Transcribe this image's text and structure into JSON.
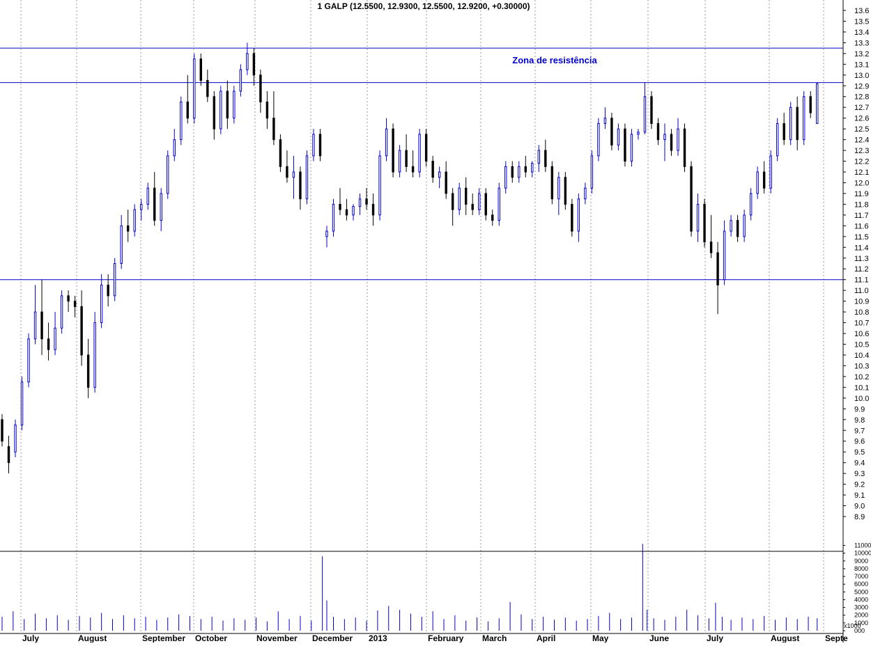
{
  "chart_data": {
    "type": "candlestick",
    "title": "1 GALP (12.5500, 12.9300, 12.5500, 12.9200, +0.30000)",
    "annotation": "Zona de resistência",
    "colors": {
      "up": "#0000cc",
      "down": "#000000",
      "line": "#0000cc",
      "grid": "#999999",
      "volume": "#0000cc"
    },
    "grid": true,
    "price_axis": {
      "min": 8.9,
      "max": 13.6,
      "step": 0.1,
      "labels": [
        "13.6",
        "13.5",
        "13.4",
        "13.3",
        "13.2",
        "13.1",
        "13.0",
        "12.9",
        "12.8",
        "12.7",
        "12.6",
        "12.5",
        "12.4",
        "12.3",
        "12.2",
        "12.1",
        "12.0",
        "11.9",
        "11.8",
        "11.7",
        "11.6",
        "11.5",
        "11.4",
        "11.3",
        "11.2",
        "11.1",
        "11.0",
        "10.9",
        "10.8",
        "10.7",
        "10.6",
        "10.5",
        "10.4",
        "10.3",
        "10.2",
        "10.1",
        "10.0",
        "9.9",
        "9.8",
        "9.7",
        "9.6",
        "9.5",
        "9.4",
        "9.3",
        "9.2",
        "9.1",
        "9.0",
        "8.9"
      ]
    },
    "volume_axis": {
      "min": 0,
      "max": 11500,
      "labels": [
        "11000",
        "10000",
        "9000",
        "8000",
        "7000",
        "6000",
        "5000",
        "4000",
        "3000",
        "2000",
        "1000",
        "000"
      ],
      "unit_label": "x1000"
    },
    "months": [
      "July",
      "August",
      "September",
      "October",
      "November",
      "December",
      "2013",
      "February",
      "March",
      "April",
      "May",
      "June",
      "July",
      "August",
      "Septe"
    ],
    "horizontal_lines": [
      13.25,
      12.93,
      11.1
    ],
    "series": [
      {
        "t": 0,
        "o": 9.8,
        "h": 9.85,
        "l": 9.55,
        "c": 9.6
      },
      {
        "t": 3,
        "o": 9.55,
        "h": 9.65,
        "l": 9.3,
        "c": 9.4
      },
      {
        "t": 6,
        "o": 9.5,
        "h": 9.8,
        "l": 9.45,
        "c": 9.75
      },
      {
        "t": 9,
        "o": 9.75,
        "h": 10.2,
        "l": 9.7,
        "c": 10.15
      },
      {
        "t": 12,
        "o": 10.15,
        "h": 10.6,
        "l": 10.1,
        "c": 10.55
      },
      {
        "t": 15,
        "o": 10.55,
        "h": 11.05,
        "l": 10.5,
        "c": 10.8
      },
      {
        "t": 18,
        "o": 10.8,
        "h": 11.1,
        "l": 10.4,
        "c": 10.55
      },
      {
        "t": 21,
        "o": 10.55,
        "h": 10.7,
        "l": 10.35,
        "c": 10.45
      },
      {
        "t": 24,
        "o": 10.45,
        "h": 10.8,
        "l": 10.4,
        "c": 10.65
      },
      {
        "t": 27,
        "o": 10.65,
        "h": 11.0,
        "l": 10.6,
        "c": 10.95
      },
      {
        "t": 30,
        "o": 10.95,
        "h": 11.0,
        "l": 10.8,
        "c": 10.9
      },
      {
        "t": 33,
        "o": 10.9,
        "h": 10.95,
        "l": 10.75,
        "c": 10.85
      },
      {
        "t": 36,
        "o": 10.85,
        "h": 11.0,
        "l": 10.3,
        "c": 10.4
      },
      {
        "t": 39,
        "o": 10.4,
        "h": 10.55,
        "l": 10.0,
        "c": 10.1
      },
      {
        "t": 42,
        "o": 10.1,
        "h": 10.8,
        "l": 10.05,
        "c": 10.7
      },
      {
        "t": 45,
        "o": 10.7,
        "h": 11.15,
        "l": 10.65,
        "c": 11.05
      },
      {
        "t": 48,
        "o": 11.05,
        "h": 11.15,
        "l": 10.85,
        "c": 10.95
      },
      {
        "t": 51,
        "o": 10.95,
        "h": 11.3,
        "l": 10.9,
        "c": 11.25
      },
      {
        "t": 54,
        "o": 11.25,
        "h": 11.7,
        "l": 11.2,
        "c": 11.6
      },
      {
        "t": 57,
        "o": 11.6,
        "h": 11.75,
        "l": 11.45,
        "c": 11.55
      },
      {
        "t": 60,
        "o": 11.55,
        "h": 11.8,
        "l": 11.5,
        "c": 11.75
      },
      {
        "t": 63,
        "o": 11.75,
        "h": 11.85,
        "l": 11.65,
        "c": 11.8
      },
      {
        "t": 66,
        "o": 11.8,
        "h": 12.0,
        "l": 11.75,
        "c": 11.95
      },
      {
        "t": 69,
        "o": 11.95,
        "h": 12.1,
        "l": 11.6,
        "c": 11.65
      },
      {
        "t": 72,
        "o": 11.65,
        "h": 11.95,
        "l": 11.55,
        "c": 11.9
      },
      {
        "t": 75,
        "o": 11.9,
        "h": 12.3,
        "l": 11.85,
        "c": 12.25
      },
      {
        "t": 78,
        "o": 12.25,
        "h": 12.5,
        "l": 12.2,
        "c": 12.4
      },
      {
        "t": 81,
        "o": 12.4,
        "h": 12.8,
        "l": 12.35,
        "c": 12.75
      },
      {
        "t": 84,
        "o": 12.75,
        "h": 13.0,
        "l": 12.55,
        "c": 12.6
      },
      {
        "t": 87,
        "o": 12.6,
        "h": 13.2,
        "l": 12.55,
        "c": 13.15
      },
      {
        "t": 90,
        "o": 13.15,
        "h": 13.2,
        "l": 12.9,
        "c": 12.95
      },
      {
        "t": 93,
        "o": 12.95,
        "h": 13.05,
        "l": 12.75,
        "c": 12.8
      },
      {
        "t": 96,
        "o": 12.8,
        "h": 12.85,
        "l": 12.4,
        "c": 12.5
      },
      {
        "t": 99,
        "o": 12.5,
        "h": 12.9,
        "l": 12.45,
        "c": 12.85
      },
      {
        "t": 102,
        "o": 12.85,
        "h": 12.95,
        "l": 12.5,
        "c": 12.6
      },
      {
        "t": 105,
        "o": 12.6,
        "h": 12.9,
        "l": 12.55,
        "c": 12.85
      },
      {
        "t": 108,
        "o": 12.85,
        "h": 13.1,
        "l": 12.8,
        "c": 13.05
      },
      {
        "t": 111,
        "o": 13.05,
        "h": 13.3,
        "l": 13.0,
        "c": 13.2
      },
      {
        "t": 114,
        "o": 13.2,
        "h": 13.25,
        "l": 12.9,
        "c": 13.0
      },
      {
        "t": 117,
        "o": 13.0,
        "h": 13.05,
        "l": 12.65,
        "c": 12.75
      },
      {
        "t": 120,
        "o": 12.75,
        "h": 12.85,
        "l": 12.5,
        "c": 12.6
      },
      {
        "t": 123,
        "o": 12.6,
        "h": 12.85,
        "l": 12.35,
        "c": 12.4
      },
      {
        "t": 126,
        "o": 12.4,
        "h": 12.45,
        "l": 12.1,
        "c": 12.15
      },
      {
        "t": 129,
        "o": 12.15,
        "h": 12.3,
        "l": 12.0,
        "c": 12.05
      },
      {
        "t": 132,
        "o": 12.05,
        "h": 12.25,
        "l": 11.85,
        "c": 12.1
      },
      {
        "t": 135,
        "o": 12.1,
        "h": 12.15,
        "l": 11.75,
        "c": 11.85
      },
      {
        "t": 138,
        "o": 11.85,
        "h": 12.3,
        "l": 11.8,
        "c": 12.25
      },
      {
        "t": 141,
        "o": 12.25,
        "h": 12.5,
        "l": 12.2,
        "c": 12.45
      },
      {
        "t": 144,
        "o": 12.45,
        "h": 12.5,
        "l": 12.2,
        "c": 12.25
      },
      {
        "t": 147,
        "o": 11.5,
        "h": 11.6,
        "l": 11.4,
        "c": 11.55
      },
      {
        "t": 150,
        "o": 11.55,
        "h": 11.85,
        "l": 11.5,
        "c": 11.8
      },
      {
        "t": 153,
        "o": 11.8,
        "h": 11.95,
        "l": 11.7,
        "c": 11.75
      },
      {
        "t": 156,
        "o": 11.75,
        "h": 11.85,
        "l": 11.65,
        "c": 11.7
      },
      {
        "t": 159,
        "o": 11.7,
        "h": 11.8,
        "l": 11.65,
        "c": 11.78
      },
      {
        "t": 162,
        "o": 11.78,
        "h": 11.9,
        "l": 11.7,
        "c": 11.85
      },
      {
        "t": 165,
        "o": 11.85,
        "h": 11.95,
        "l": 11.75,
        "c": 11.8
      },
      {
        "t": 168,
        "o": 11.8,
        "h": 11.9,
        "l": 11.6,
        "c": 11.7
      },
      {
        "t": 171,
        "o": 11.7,
        "h": 12.3,
        "l": 11.65,
        "c": 12.25
      },
      {
        "t": 174,
        "o": 12.25,
        "h": 12.6,
        "l": 12.2,
        "c": 12.5
      },
      {
        "t": 177,
        "o": 12.5,
        "h": 12.55,
        "l": 12.05,
        "c": 12.1
      },
      {
        "t": 180,
        "o": 12.1,
        "h": 12.35,
        "l": 12.05,
        "c": 12.3
      },
      {
        "t": 183,
        "o": 12.3,
        "h": 12.45,
        "l": 12.1,
        "c": 12.15
      },
      {
        "t": 186,
        "o": 12.15,
        "h": 12.3,
        "l": 12.05,
        "c": 12.1
      },
      {
        "t": 189,
        "o": 12.1,
        "h": 12.5,
        "l": 12.05,
        "c": 12.45
      },
      {
        "t": 192,
        "o": 12.45,
        "h": 12.5,
        "l": 12.15,
        "c": 12.2
      },
      {
        "t": 195,
        "o": 12.2,
        "h": 12.25,
        "l": 12.0,
        "c": 12.05
      },
      {
        "t": 198,
        "o": 12.05,
        "h": 12.15,
        "l": 11.95,
        "c": 12.1
      },
      {
        "t": 201,
        "o": 12.1,
        "h": 12.2,
        "l": 11.85,
        "c": 11.9
      },
      {
        "t": 204,
        "o": 11.9,
        "h": 11.95,
        "l": 11.6,
        "c": 11.75
      },
      {
        "t": 207,
        "o": 11.75,
        "h": 12.0,
        "l": 11.7,
        "c": 11.95
      },
      {
        "t": 210,
        "o": 11.95,
        "h": 12.05,
        "l": 11.7,
        "c": 11.8
      },
      {
        "t": 213,
        "o": 11.8,
        "h": 11.9,
        "l": 11.7,
        "c": 11.75
      },
      {
        "t": 216,
        "o": 11.75,
        "h": 11.95,
        "l": 11.7,
        "c": 11.9
      },
      {
        "t": 219,
        "o": 11.9,
        "h": 11.95,
        "l": 11.65,
        "c": 11.7
      },
      {
        "t": 222,
        "o": 11.7,
        "h": 11.75,
        "l": 11.6,
        "c": 11.65
      },
      {
        "t": 225,
        "o": 11.65,
        "h": 12.0,
        "l": 11.6,
        "c": 11.95
      },
      {
        "t": 228,
        "o": 11.95,
        "h": 12.2,
        "l": 11.9,
        "c": 12.15
      },
      {
        "t": 231,
        "o": 12.15,
        "h": 12.2,
        "l": 12.0,
        "c": 12.05
      },
      {
        "t": 234,
        "o": 12.05,
        "h": 12.2,
        "l": 12.0,
        "c": 12.15
      },
      {
        "t": 237,
        "o": 12.15,
        "h": 12.25,
        "l": 12.05,
        "c": 12.1
      },
      {
        "t": 240,
        "o": 12.1,
        "h": 12.2,
        "l": 12.05,
        "c": 12.18
      },
      {
        "t": 243,
        "o": 12.18,
        "h": 12.35,
        "l": 12.1,
        "c": 12.3
      },
      {
        "t": 246,
        "o": 12.3,
        "h": 12.4,
        "l": 12.1,
        "c": 12.15
      },
      {
        "t": 249,
        "o": 12.15,
        "h": 12.2,
        "l": 11.8,
        "c": 11.85
      },
      {
        "t": 252,
        "o": 11.85,
        "h": 12.1,
        "l": 11.7,
        "c": 12.05
      },
      {
        "t": 255,
        "o": 12.05,
        "h": 12.1,
        "l": 11.75,
        "c": 11.8
      },
      {
        "t": 258,
        "o": 11.8,
        "h": 11.85,
        "l": 11.5,
        "c": 11.55
      },
      {
        "t": 261,
        "o": 11.55,
        "h": 11.9,
        "l": 11.45,
        "c": 11.85
      },
      {
        "t": 264,
        "o": 11.85,
        "h": 12.0,
        "l": 11.8,
        "c": 11.95
      },
      {
        "t": 267,
        "o": 11.95,
        "h": 12.3,
        "l": 11.9,
        "c": 12.25
      },
      {
        "t": 270,
        "o": 12.25,
        "h": 12.6,
        "l": 12.2,
        "c": 12.55
      },
      {
        "t": 273,
        "o": 12.55,
        "h": 12.7,
        "l": 12.5,
        "c": 12.6
      },
      {
        "t": 276,
        "o": 12.6,
        "h": 12.65,
        "l": 12.3,
        "c": 12.35
      },
      {
        "t": 279,
        "o": 12.35,
        "h": 12.55,
        "l": 12.3,
        "c": 12.5
      },
      {
        "t": 282,
        "o": 12.5,
        "h": 12.55,
        "l": 12.15,
        "c": 12.2
      },
      {
        "t": 285,
        "o": 12.2,
        "h": 12.5,
        "l": 12.15,
        "c": 12.45
      },
      {
        "t": 288,
        "o": 12.45,
        "h": 12.5,
        "l": 12.4,
        "c": 12.47
      },
      {
        "t": 291,
        "o": 12.47,
        "h": 12.93,
        "l": 12.45,
        "c": 12.8
      },
      {
        "t": 294,
        "o": 12.8,
        "h": 12.85,
        "l": 12.5,
        "c": 12.55
      },
      {
        "t": 297,
        "o": 12.55,
        "h": 12.6,
        "l": 12.35,
        "c": 12.4
      },
      {
        "t": 300,
        "o": 12.4,
        "h": 12.55,
        "l": 12.2,
        "c": 12.45
      },
      {
        "t": 303,
        "o": 12.45,
        "h": 12.5,
        "l": 12.25,
        "c": 12.3
      },
      {
        "t": 306,
        "o": 12.3,
        "h": 12.6,
        "l": 12.25,
        "c": 12.5
      },
      {
        "t": 309,
        "o": 12.5,
        "h": 12.55,
        "l": 12.1,
        "c": 12.15
      },
      {
        "t": 312,
        "o": 12.15,
        "h": 12.2,
        "l": 11.5,
        "c": 11.55
      },
      {
        "t": 315,
        "o": 11.55,
        "h": 11.9,
        "l": 11.45,
        "c": 11.8
      },
      {
        "t": 318,
        "o": 11.8,
        "h": 11.85,
        "l": 11.4,
        "c": 11.45
      },
      {
        "t": 321,
        "o": 11.45,
        "h": 11.7,
        "l": 11.3,
        "c": 11.35
      },
      {
        "t": 324,
        "o": 11.35,
        "h": 11.45,
        "l": 10.78,
        "c": 11.05
      },
      {
        "t": 327,
        "o": 11.1,
        "h": 11.65,
        "l": 11.05,
        "c": 11.55
      },
      {
        "t": 330,
        "o": 11.55,
        "h": 11.7,
        "l": 11.5,
        "c": 11.65
      },
      {
        "t": 333,
        "o": 11.65,
        "h": 11.7,
        "l": 11.45,
        "c": 11.5
      },
      {
        "t": 336,
        "o": 11.5,
        "h": 11.75,
        "l": 11.45,
        "c": 11.7
      },
      {
        "t": 339,
        "o": 11.7,
        "h": 11.95,
        "l": 11.65,
        "c": 11.9
      },
      {
        "t": 342,
        "o": 11.9,
        "h": 12.15,
        "l": 11.85,
        "c": 12.1
      },
      {
        "t": 345,
        "o": 12.1,
        "h": 12.2,
        "l": 11.9,
        "c": 11.95
      },
      {
        "t": 348,
        "o": 11.95,
        "h": 12.3,
        "l": 11.9,
        "c": 12.25
      },
      {
        "t": 351,
        "o": 12.25,
        "h": 12.6,
        "l": 12.2,
        "c": 12.55
      },
      {
        "t": 354,
        "o": 12.55,
        "h": 12.65,
        "l": 12.35,
        "c": 12.4
      },
      {
        "t": 357,
        "o": 12.4,
        "h": 12.75,
        "l": 12.35,
        "c": 12.7
      },
      {
        "t": 360,
        "o": 12.7,
        "h": 12.8,
        "l": 12.3,
        "c": 12.4
      },
      {
        "t": 363,
        "o": 12.4,
        "h": 12.85,
        "l": 12.35,
        "c": 12.8
      },
      {
        "t": 366,
        "o": 12.8,
        "h": 12.85,
        "l": 12.6,
        "c": 12.65
      },
      {
        "t": 369,
        "o": 12.55,
        "h": 12.93,
        "l": 12.55,
        "c": 12.92
      }
    ],
    "volume": [
      {
        "t": 0,
        "v": 1800
      },
      {
        "t": 5,
        "v": 2500
      },
      {
        "t": 10,
        "v": 1500
      },
      {
        "t": 15,
        "v": 2200
      },
      {
        "t": 20,
        "v": 1600
      },
      {
        "t": 25,
        "v": 2000
      },
      {
        "t": 30,
        "v": 1400
      },
      {
        "t": 35,
        "v": 1900
      },
      {
        "t": 40,
        "v": 1700
      },
      {
        "t": 45,
        "v": 2300
      },
      {
        "t": 50,
        "v": 1500
      },
      {
        "t": 55,
        "v": 2000
      },
      {
        "t": 60,
        "v": 1600
      },
      {
        "t": 65,
        "v": 1800
      },
      {
        "t": 70,
        "v": 1400
      },
      {
        "t": 75,
        "v": 1700
      },
      {
        "t": 80,
        "v": 2100
      },
      {
        "t": 85,
        "v": 1900
      },
      {
        "t": 90,
        "v": 1500
      },
      {
        "t": 95,
        "v": 1800
      },
      {
        "t": 100,
        "v": 1300
      },
      {
        "t": 105,
        "v": 1600
      },
      {
        "t": 110,
        "v": 1400
      },
      {
        "t": 115,
        "v": 1700
      },
      {
        "t": 120,
        "v": 1200
      },
      {
        "t": 125,
        "v": 2500
      },
      {
        "t": 130,
        "v": 1500
      },
      {
        "t": 135,
        "v": 1900
      },
      {
        "t": 140,
        "v": 1300
      },
      {
        "t": 145,
        "v": 9600
      },
      {
        "t": 147,
        "v": 3900
      },
      {
        "t": 150,
        "v": 1800
      },
      {
        "t": 155,
        "v": 1500
      },
      {
        "t": 160,
        "v": 1700
      },
      {
        "t": 165,
        "v": 1300
      },
      {
        "t": 170,
        "v": 2600
      },
      {
        "t": 175,
        "v": 3200
      },
      {
        "t": 180,
        "v": 2700
      },
      {
        "t": 185,
        "v": 2200
      },
      {
        "t": 190,
        "v": 1800
      },
      {
        "t": 195,
        "v": 2500
      },
      {
        "t": 200,
        "v": 1500
      },
      {
        "t": 205,
        "v": 2000
      },
      {
        "t": 210,
        "v": 1300
      },
      {
        "t": 215,
        "v": 1700
      },
      {
        "t": 220,
        "v": 1200
      },
      {
        "t": 225,
        "v": 1600
      },
      {
        "t": 230,
        "v": 3700
      },
      {
        "t": 235,
        "v": 2100
      },
      {
        "t": 240,
        "v": 1500
      },
      {
        "t": 245,
        "v": 1800
      },
      {
        "t": 250,
        "v": 1400
      },
      {
        "t": 255,
        "v": 1700
      },
      {
        "t": 260,
        "v": 1300
      },
      {
        "t": 265,
        "v": 1500
      },
      {
        "t": 270,
        "v": 1900
      },
      {
        "t": 275,
        "v": 2300
      },
      {
        "t": 280,
        "v": 1500
      },
      {
        "t": 285,
        "v": 1700
      },
      {
        "t": 290,
        "v": 11200
      },
      {
        "t": 292,
        "v": 2700
      },
      {
        "t": 295,
        "v": 1600
      },
      {
        "t": 300,
        "v": 1400
      },
      {
        "t": 305,
        "v": 1800
      },
      {
        "t": 310,
        "v": 2700
      },
      {
        "t": 315,
        "v": 2000
      },
      {
        "t": 320,
        "v": 1600
      },
      {
        "t": 323,
        "v": 3600
      },
      {
        "t": 326,
        "v": 1800
      },
      {
        "t": 330,
        "v": 1400
      },
      {
        "t": 335,
        "v": 1700
      },
      {
        "t": 340,
        "v": 1500
      },
      {
        "t": 345,
        "v": 1900
      },
      {
        "t": 350,
        "v": 1400
      },
      {
        "t": 355,
        "v": 1700
      },
      {
        "t": 360,
        "v": 1500
      },
      {
        "t": 365,
        "v": 1800
      },
      {
        "t": 369,
        "v": 1600
      }
    ]
  }
}
